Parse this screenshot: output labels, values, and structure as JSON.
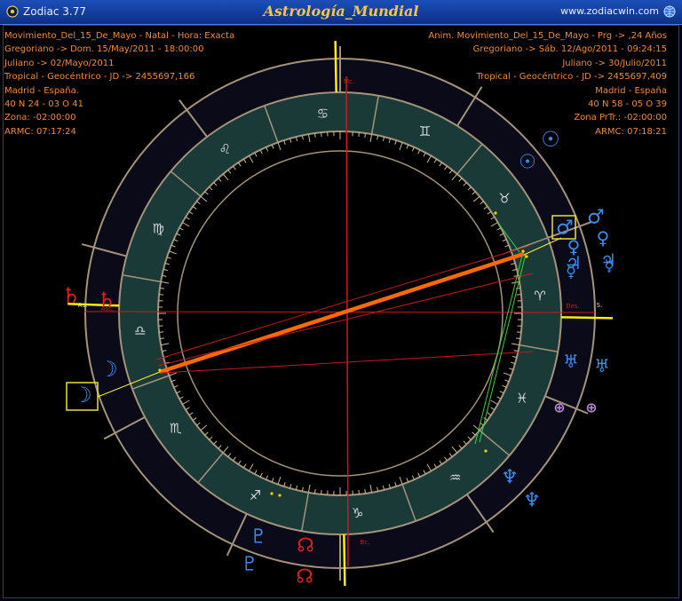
{
  "window": {
    "app_title": "Zodiac 3.77",
    "chart_title": "Astrología_Mundial",
    "website": "www.zodiacwin.com"
  },
  "left_info": [
    "Movimiento_Del_15_De_Mayo - Natal - Hora: Exacta",
    "Gregoriano -> Dom. 15/May/2011 - 18:00:00",
    "Juliano -> 02/Mayo/2011",
    "Tropical - Geocéntrico - JD -> 2455697,166",
    "Madrid - España.",
    "40 N 24 - 03 O 41",
    "Zona: -02:00:00",
    "ARMC: 07:17:24"
  ],
  "right_info": [
    "Anim. Movimiento_Del_15_De_Mayo - Prg -> ,24 Años",
    "Gregoriano -> Sáb. 12/Ago/2011 - 09:24:15",
    "Juliano -> 30/Julio/2011",
    "Tropical - Geocéntrico - JD -> 2455697,409",
    "Madrid - España",
    "40 N 58 - 05 O 39",
    "Zona PrTr.: -02:00:00",
    "ARMC: 07:18:21"
  ],
  "axis_labels": {
    "mc": "Mc.",
    "bc": "Bc.",
    "asc": "Asc.",
    "as": "As.",
    "des": "Des.",
    "s": "S."
  },
  "zodiac_signs": [
    {
      "name": "cancer",
      "glyph": "♋"
    },
    {
      "name": "gemini",
      "glyph": "♊"
    },
    {
      "name": "taurus",
      "glyph": "♉"
    },
    {
      "name": "aries",
      "glyph": "♈"
    },
    {
      "name": "pisces",
      "glyph": "♓"
    },
    {
      "name": "aquarius",
      "glyph": "♒"
    },
    {
      "name": "capricorn",
      "glyph": "♑"
    },
    {
      "name": "sagittarius",
      "glyph": "♐"
    },
    {
      "name": "scorpio",
      "glyph": "♏"
    },
    {
      "name": "libra",
      "glyph": "♎"
    },
    {
      "name": "virgo",
      "glyph": "♍"
    },
    {
      "name": "leo",
      "glyph": "♌"
    }
  ],
  "planets": [
    {
      "name": "sun-natal",
      "glyph": "☉"
    },
    {
      "name": "sun-progressed",
      "glyph": "☉"
    },
    {
      "name": "mars-natal",
      "glyph": "♂"
    },
    {
      "name": "mars-progressed",
      "glyph": "♂"
    },
    {
      "name": "venus-natal",
      "glyph": "♀"
    },
    {
      "name": "venus-progressed",
      "glyph": "♀"
    },
    {
      "name": "jupiter-natal",
      "glyph": "♃"
    },
    {
      "name": "jupiter-progressed",
      "glyph": "♃"
    },
    {
      "name": "mercury-natal",
      "glyph": "☿"
    },
    {
      "name": "mercury-progressed",
      "glyph": "☿"
    },
    {
      "name": "uranus-natal",
      "glyph": "♅"
    },
    {
      "name": "uranus-progressed",
      "glyph": "♅"
    },
    {
      "name": "fortune-natal",
      "glyph": "⊕"
    },
    {
      "name": "fortune-progressed",
      "glyph": "⊕"
    },
    {
      "name": "neptune-natal",
      "glyph": "♆"
    },
    {
      "name": "neptune-progressed",
      "glyph": "♆"
    },
    {
      "name": "pluto-natal",
      "glyph": "♇"
    },
    {
      "name": "pluto-progressed",
      "glyph": "♇"
    },
    {
      "name": "node-natal",
      "glyph": "☊"
    },
    {
      "name": "node-progressed",
      "glyph": "☊"
    },
    {
      "name": "moon-natal",
      "glyph": "☽"
    },
    {
      "name": "moon-progressed",
      "glyph": "☽"
    },
    {
      "name": "saturn-natal",
      "glyph": "♄"
    },
    {
      "name": "saturn-progressed",
      "glyph": "♄"
    }
  ],
  "colors": {
    "orange_text": "#f28a2e",
    "title_gold": "#f3c64a",
    "zodiac_band": "#1a3a38",
    "outer_ring": "#0a0a18",
    "rim": "#a5937a",
    "planet_blue": "#3a8cf0",
    "planet_red": "#e0201c",
    "axis_yellow": "#ffee00",
    "aspect_orange": "#ff6a00",
    "aspect_red": "#c81818",
    "aspect_green": "#3ad23a"
  }
}
